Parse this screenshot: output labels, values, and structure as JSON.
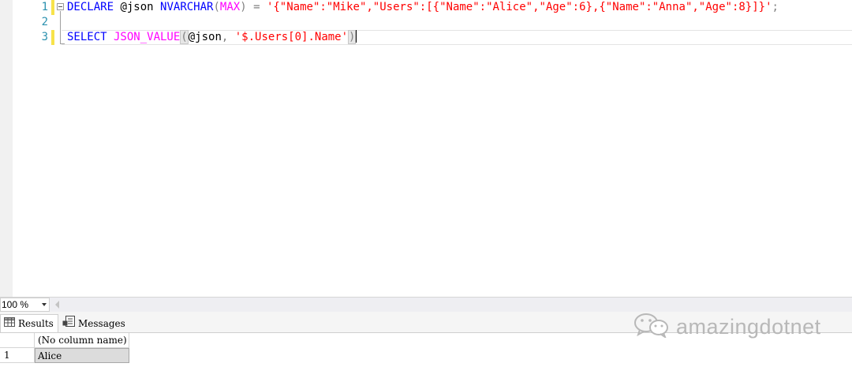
{
  "editor": {
    "line_numbers": [
      "1",
      "2",
      "3"
    ],
    "line1": {
      "declare": "DECLARE",
      "variable": " @json ",
      "type": "NVARCHAR",
      "paren_open": "(",
      "max": "MAX",
      "paren_close": ")",
      "equals": " = ",
      "string": "'{\"Name\":\"Mike\",\"Users\":[{\"Name\":\"Alice\",\"Age\":6},{\"Name\":\"Anna\",\"Age\":8}]}'",
      "semicolon": ";"
    },
    "line3": {
      "select": "SELECT",
      "func": " JSON_VALUE",
      "paren_open": "(",
      "arg1": "@json",
      "comma": ", ",
      "arg2": "'$.Users[0].Name'",
      "paren_close": ")"
    }
  },
  "status_bar": {
    "zoom": "100 %"
  },
  "results": {
    "tabs": [
      {
        "label": "Results",
        "icon": "grid-icon"
      },
      {
        "label": "Messages",
        "icon": "messages-icon"
      }
    ],
    "column_header": "(No column name)",
    "rows": [
      {
        "num": "1",
        "value": "Alice"
      }
    ]
  },
  "watermark": {
    "text": "amazingdotnet",
    "icon": "wechat-icon"
  },
  "colors": {
    "keyword": "#0000ff",
    "function": "#ff00ff",
    "string": "#ff0000",
    "operator": "#808080",
    "line_number": "#2b91af",
    "change_bar": "#f7e34a"
  }
}
